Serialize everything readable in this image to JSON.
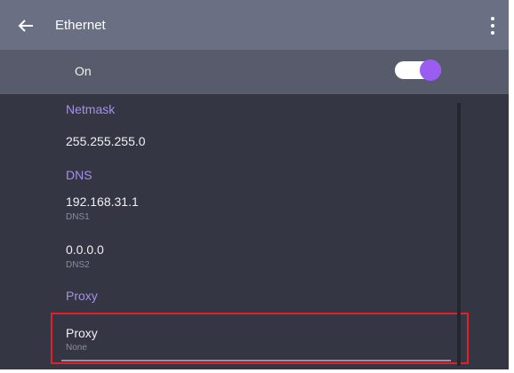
{
  "appbar": {
    "title": "Ethernet",
    "back_icon": "arrow-left-icon",
    "more_icon": "more-vert-icon"
  },
  "ethernet_switch": {
    "label": "On",
    "checked": true,
    "accent_color": "#9b5cf2"
  },
  "settings": {
    "netmask": {
      "header": "Netmask",
      "value": "255.255.255.0"
    },
    "dns": {
      "header": "DNS",
      "items": [
        {
          "value": "192.168.31.1",
          "label": "DNS1"
        },
        {
          "value": "0.0.0.0",
          "label": "DNS2"
        }
      ]
    },
    "proxy": {
      "header": "Proxy",
      "item": {
        "title": "Proxy",
        "value": "None"
      }
    }
  },
  "colors": {
    "appbar": "#6a6f84",
    "switch_row": "#575b6c",
    "background": "#343743",
    "section_header": "#a98cf0",
    "highlight_border": "#e3202a"
  }
}
